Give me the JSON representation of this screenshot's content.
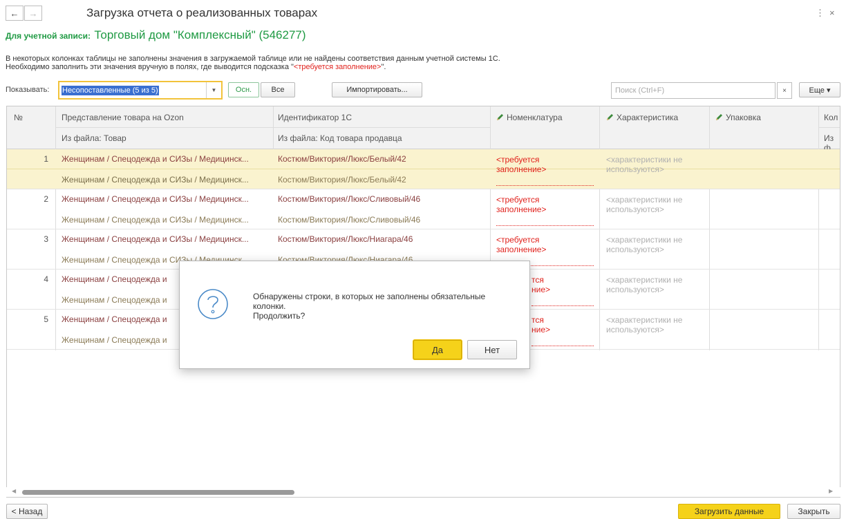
{
  "window": {
    "title": "Загрузка отчета о реализованных товарах",
    "back_icon": "←",
    "forward_icon": "→",
    "menu_icon": "⋮",
    "close_icon": "×"
  },
  "account": {
    "label": "Для учетной записи:",
    "value": "Торговый дом \"Комплексный\" (546277)"
  },
  "info": {
    "line1": "В некоторых колонках таблицы не заполнены значения в загружаемой таблице или не найдены соответствия данным учетной системы 1С.",
    "line2_prefix": "Необходимо заполнить эти значения вручную в полях, где выводится подсказка \"",
    "line2_hint": "<требуется заполнение>",
    "line2_suffix": "\"."
  },
  "filter": {
    "label": "Показывать:",
    "selected": "Несопоставленные (5 из 5)",
    "btn_main": "Осн.",
    "btn_all": "Все",
    "btn_import": "Импортировать...",
    "search_placeholder": "Поиск (Ctrl+F)",
    "search_clear": "×",
    "more": "Еще ▾"
  },
  "table": {
    "headers": {
      "num": "№",
      "product": "Представление товара на Ozon",
      "product_sub": "Из файла: Товар",
      "id": "Идентификатор 1С",
      "id_sub": "Из файла: Код товара продавца",
      "nomenclature": "Номенклатура",
      "characteristic": "Характеристика",
      "package": "Упаковка",
      "qty": "Кол",
      "qty_sub": "Из ф"
    },
    "required_1": "<требуется",
    "required_2": "заполнение>",
    "char_1": "<характеристики не",
    "char_2": "используются>",
    "rows": [
      {
        "num": "1",
        "product": "Женщинам / Спецодежда и СИЗы / Медицинск...",
        "product_file": "Женщинам / Спецодежда и СИЗы / Медицинск...",
        "id": "Костюм/Виктория/Люкс/Белый/42",
        "id_file": "Костюм/Виктория/Люкс/Белый/42"
      },
      {
        "num": "2",
        "product": "Женщинам / Спецодежда и СИЗы / Медицинск...",
        "product_file": "Женщинам / Спецодежда и СИЗы / Медицинск...",
        "id": "Костюм/Виктория/Люкс/Сливовый/46",
        "id_file": "Костюм/Виктория/Люкс/Сливовый/46"
      },
      {
        "num": "3",
        "product": "Женщинам / Спецодежда и СИЗы / Медицинск...",
        "product_file": "Женщинам / Спецодежда и СИЗы / Медицинск...",
        "id": "Костюм/Виктория/Люкс/Ниагара/46",
        "id_file": "Костюм/Виктория/Люкс/Ниагара/46"
      },
      {
        "num": "4",
        "product": "Женщинам / Спецодежда и",
        "product_file": "Женщинам / Спецодежда и",
        "req_tail_1": "тся",
        "req_tail_2": "ние>"
      },
      {
        "num": "5",
        "product": "Женщинам / Спецодежда и",
        "product_file": "Женщинам / Спецодежда и",
        "req_tail_1": "тся",
        "req_tail_2": "ние>"
      }
    ]
  },
  "dialog": {
    "icon": "?",
    "message_1": "Обнаружены строки, в которых не заполнены обязательные",
    "message_2": "колонки.",
    "message_3": "Продолжить?",
    "yes": "Да",
    "no": "Нет"
  },
  "footer": {
    "back": "< Назад",
    "load": "Загрузить данные",
    "close": "Закрыть"
  },
  "colors": {
    "accent_green": "#1f9a43",
    "required_red": "#e0201b",
    "primary_yellow": "#f5d21a",
    "selected_row": "#faf3cf"
  }
}
